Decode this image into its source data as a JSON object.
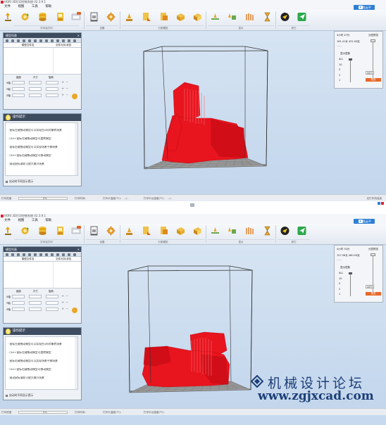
{
  "screens": [
    {
      "title": "HORI 3D打印控制系统 V2.3.9.1",
      "menu": [
        "文件",
        "视图",
        "工具",
        "帮助"
      ],
      "login": "登陆云平台",
      "ribbon_groups": [
        "打印及打印",
        "设置",
        "分割模型",
        "显示",
        "其它"
      ],
      "model_panel": {
        "title": "模型列表",
        "columns": [
          "模型文件名",
          "文件/切片状态"
        ],
        "transform_headers": [
          "缩放",
          "尺寸",
          "旋转"
        ],
        "axes": [
          "X轴",
          "Y轴",
          "Z轴"
        ]
      },
      "tips": {
        "title": "操作提示",
        "items": [
          "· 鼠标左键拖动模型可以实现在x向对象转场景",
          "· Ctrl+鼠标左键拖动模型可旋转模型",
          "· 鼠标右键拖动模型可以实现场景平移场景",
          "· Ctrl+鼠标右键拖动模型可移动模型",
          "· 滚动鼠标滚轮可放大缩小场景"
        ],
        "footer": "启动时不再显示提示"
      },
      "layers": {
        "time": "4小时 47分",
        "filament": "161.41长 431.00克",
        "dash": "------",
        "switch_label": "分层预览",
        "display": "显示层数",
        "levels": [
          "ALL",
          "10",
          "5",
          "2",
          "1"
        ],
        "layer_value": "1873",
        "button": "预览"
      },
      "status": {
        "left": "打印进度",
        "progress": "0%",
        "items": [
          "打印时间：",
          "打印头温度(℃)：",
          "打印平台温度(℃)：",
          "--/--"
        ],
        "right": "无打印机连接"
      }
    },
    {
      "title": "HORI 3D打印控制系统 V2.3.9.1",
      "menu": [
        "文件",
        "视图",
        "工具",
        "帮助"
      ],
      "login": "登陆云平台",
      "ribbon_groups": [
        "打印及打印",
        "设置",
        "分割模型",
        "显示",
        "其它"
      ],
      "model_panel": {
        "title": "模型列表",
        "columns": [
          "模型文件名",
          "文件/切片状态"
        ],
        "transform_headers": [
          "缩放",
          "尺寸",
          "旋转"
        ],
        "axes": [
          "X轴",
          "Y轴",
          "Z轴"
        ]
      },
      "tips": {
        "title": "操作提示",
        "items": [
          "· 鼠标左键拖动模型可以实现在x向对象转场景",
          "· Ctrl+鼠标左键拖动模型可旋转模型",
          "· 鼠标右键拖动模型可以实现场景平移场景",
          "· Ctrl+鼠标右键拖动模型可移动模型",
          "· 滚动鼠标滚轮可放大缩小场景"
        ],
        "footer": "启动时不再显示提示"
      },
      "layers": {
        "time": "4小时 32分",
        "filament": "157.56长 460.00克",
        "dash": "------",
        "switch_label": "分层预览",
        "display": "显示层数",
        "levels": [
          "ALL",
          "10",
          "5",
          "2",
          "1"
        ],
        "layer_value": "1873",
        "button": "预览"
      },
      "status": {
        "left": "打印进度",
        "progress": "0%",
        "items": [
          "打印时间：",
          "打印头温度(℃)：",
          "打印平台温度(℃)：",
          "--/--"
        ],
        "right": "无打印机连接"
      }
    }
  ],
  "watermark": {
    "text_cn": "机械设计论坛",
    "url": "www.zgjxcad.com"
  },
  "colors": {
    "model": "#e8141e",
    "viewport": "#c8daee",
    "panel_header": "#3e4c60",
    "accent": "#e8672a"
  },
  "icons": [
    "load-model-icon",
    "rotate-icon",
    "slice-icon",
    "save-gcode-icon",
    "print-icon",
    "printer-icon",
    "settings-gear-icon",
    "split-x-icon",
    "split-y-icon",
    "split-z-icon",
    "split-auto-icon",
    "view-front-icon",
    "view-side-icon",
    "view-top-icon",
    "support-icon",
    "help-icon",
    "send-icon"
  ]
}
